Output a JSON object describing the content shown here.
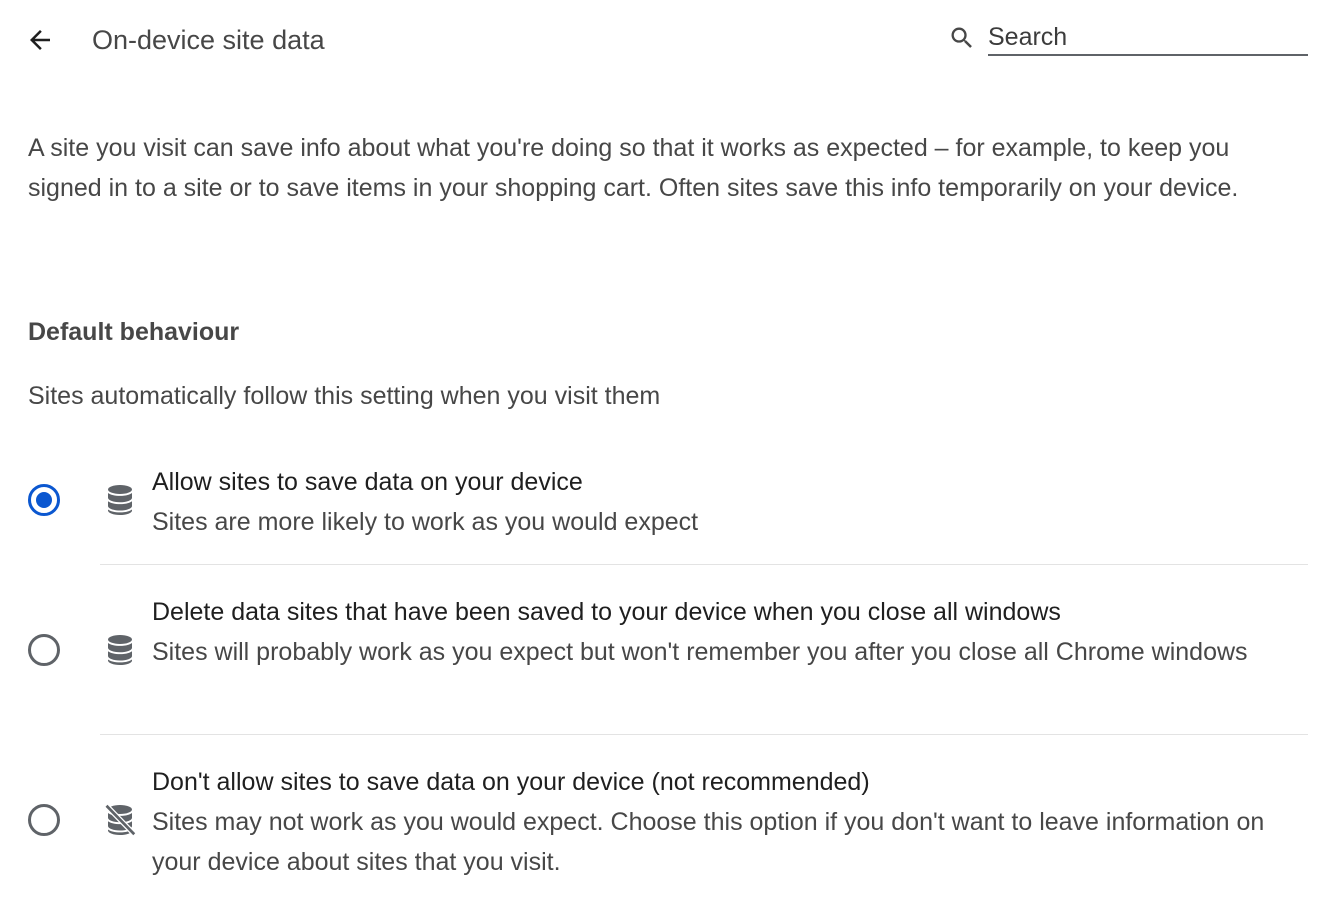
{
  "header": {
    "title": "On-device site data",
    "back_icon": "arrow-back-icon",
    "search": {
      "placeholder": "Search",
      "value": "",
      "icon": "search-icon"
    }
  },
  "description": "A site you visit can save info about what you're doing so that it works as expected – for example, to keep you signed in to a site or to save items in your shopping cart. Often sites save this info temporarily on your device.",
  "default_behaviour": {
    "heading": "Default behaviour",
    "subtext": "Sites automatically follow this setting when you visit them",
    "options": [
      {
        "label": "Allow sites to save data on your device",
        "sublabel": "Sites are more likely to work as you would expect",
        "icon": "database-icon",
        "selected": true
      },
      {
        "label": "Delete data sites that have been saved to your device when you close all windows",
        "sublabel": "Sites will probably work as you expect but won't remember you after you close all Chrome windows",
        "icon": "database-icon",
        "selected": false
      },
      {
        "label": "Don't allow sites to save data on your device (not recommended)",
        "sublabel": "Sites may not work as you would expect. Choose this option if you don't want to leave information on your device about sites that you visit.",
        "icon": "database-off-icon",
        "selected": false
      }
    ]
  },
  "colors": {
    "accent": "#0b57d0",
    "text_primary": "#1f1f1f",
    "text_secondary": "#474747",
    "divider": "#e3e3e3"
  }
}
